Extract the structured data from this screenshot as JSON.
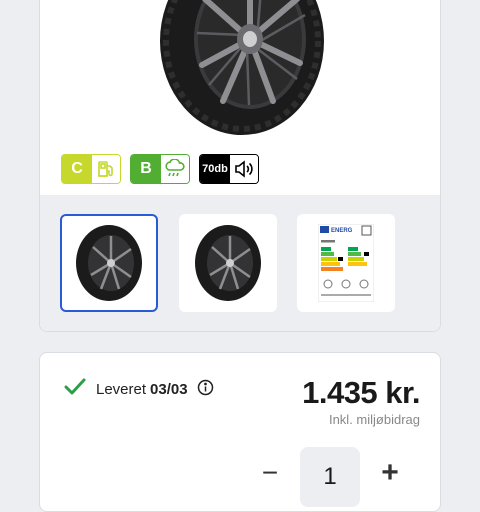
{
  "product": {
    "labels": {
      "fuel_class": "C",
      "wet_grip_class": "B",
      "noise_level": "70db"
    },
    "gallery": [
      {
        "name": "tire-image-1",
        "selected": true
      },
      {
        "name": "tire-image-2",
        "selected": false
      },
      {
        "name": "eu-energy-label",
        "selected": false
      }
    ],
    "eu_label_heading": "ENERG"
  },
  "purchase": {
    "delivery_text": "Leveret",
    "delivery_date": "03/03",
    "price": "1.435 kr.",
    "price_note": "Inkl. miljøbidrag",
    "quantity": "1",
    "minus_label": "−",
    "plus_label": "+"
  },
  "colors": {
    "fuel_class": "#c5d82b",
    "wet_grip_class": "#52ae32",
    "noise": "#000000",
    "selected_border": "#2a5bd7",
    "check": "#2e9e47"
  }
}
